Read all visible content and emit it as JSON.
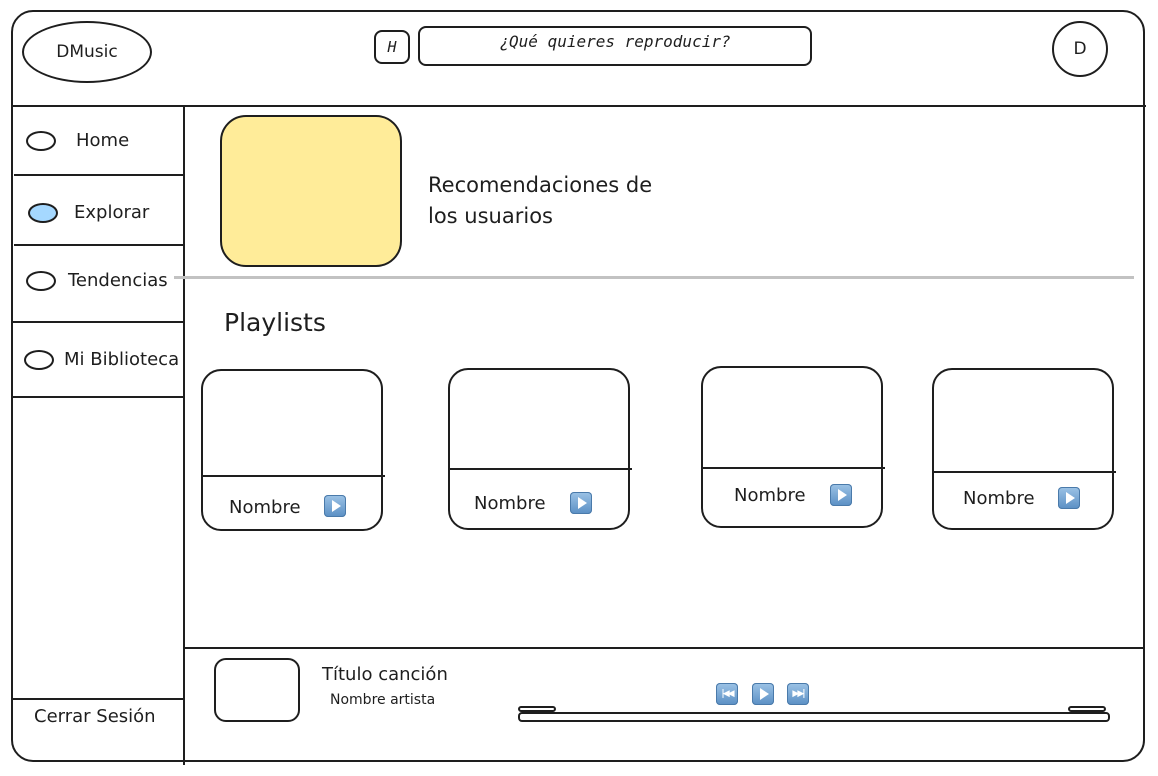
{
  "header": {
    "logo": "DMusic",
    "home_letter": "H",
    "search_placeholder": "¿Qué quieres reproducir?",
    "avatar_letter": "D"
  },
  "sidebar": {
    "items": [
      {
        "label": "Home",
        "active": false
      },
      {
        "label": "Explorar",
        "active": true
      },
      {
        "label": "Tendencias",
        "active": false
      },
      {
        "label": "Mi Biblioteca",
        "active": false
      }
    ],
    "logout": "Cerrar Sesión"
  },
  "recommendations": {
    "title": "Recomendaciones de los usuarios"
  },
  "playlists": {
    "title": "Playlists",
    "items": [
      {
        "name": "Nombre"
      },
      {
        "name": "Nombre"
      },
      {
        "name": "Nombre"
      },
      {
        "name": "Nombre"
      }
    ]
  },
  "player": {
    "song_title": "Título canción",
    "artist": "Nombre artista",
    "progress": 0
  },
  "colors": {
    "active_nav": "#a5d8ff",
    "recommendation_thumb": "#ffec99",
    "play_button": "#5a8fc4",
    "stroke": "#1e1e1e"
  }
}
